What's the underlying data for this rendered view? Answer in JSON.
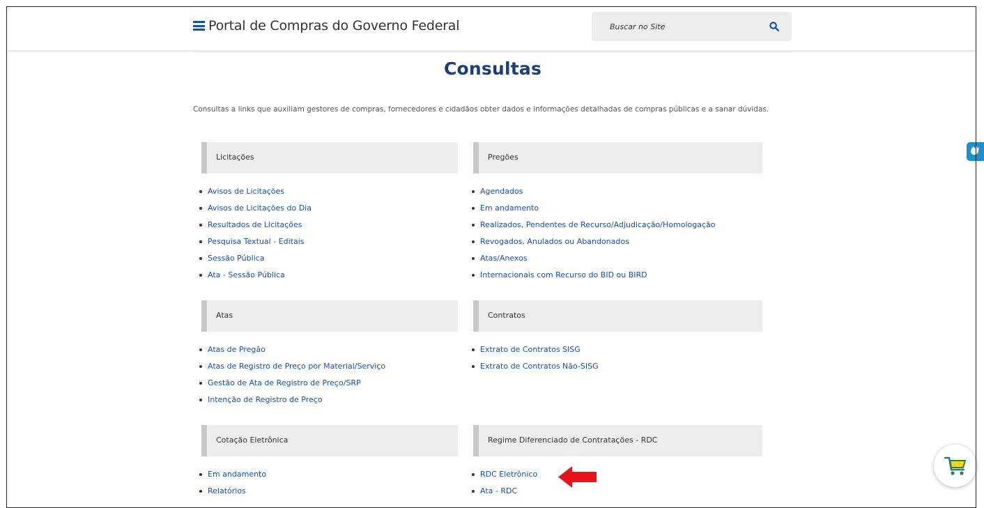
{
  "header": {
    "site_title": "Portal de Compras do Governo Federal",
    "search_placeholder": "Buscar no Site"
  },
  "page": {
    "title": "Consultas",
    "intro": "Consultas a links que auxiliam gestores de compras, fornecedores e cidadãos obter dados e informações detalhadas de compras públicas e a sanar dúvidas."
  },
  "sections": {
    "licitacoes": {
      "title": "Licitações",
      "links": [
        "Avisos de Licitações",
        "Avisos de Licitações do Dia",
        "Resultados de Licitações",
        "Pesquisa Textual - Editais",
        "Sessão Pública",
        "Ata - Sessão Pública"
      ]
    },
    "pregoes": {
      "title": "Pregões",
      "links": [
        "Agendados",
        "Em andamento",
        "Realizados, Pendentes de Recurso/Adjudicação/Homologação",
        "Revogados, Anulados ou Abandonados",
        "Atas/Anexos",
        "Internacionais com Recurso do BID ou BIRD"
      ]
    },
    "atas": {
      "title": "Atas",
      "links": [
        "Atas de Pregão",
        "Atas de Registro de Preço por Material/Serviço",
        "Gestão de Ata de Registro de Preço/SRP",
        "Intenção de Registro de Preço"
      ]
    },
    "contratos": {
      "title": "Contratos",
      "links": [
        "Extrato de Contratos SISG",
        "Extrato de Contratos Não-SISG"
      ]
    },
    "cotacao": {
      "title": "Cotação Eletrônica",
      "links": [
        "Em andamento",
        "Relatórios"
      ]
    },
    "rdc": {
      "title": "Regime Diferenciado de Contratações - RDC",
      "links": [
        "RDC Eletrônico",
        "Ata - RDC"
      ]
    }
  },
  "colors": {
    "accent_blue": "#1351b4",
    "title_blue": "#1a3e7a",
    "panel_bg": "#ededed",
    "arrow_red": "#e8141b"
  },
  "icons": {
    "menu": "menu-icon",
    "search": "search-icon",
    "accessibility": "vlibras-hands-icon",
    "cart": "shopping-cart-icon",
    "annotation": "red-arrow-icon"
  }
}
